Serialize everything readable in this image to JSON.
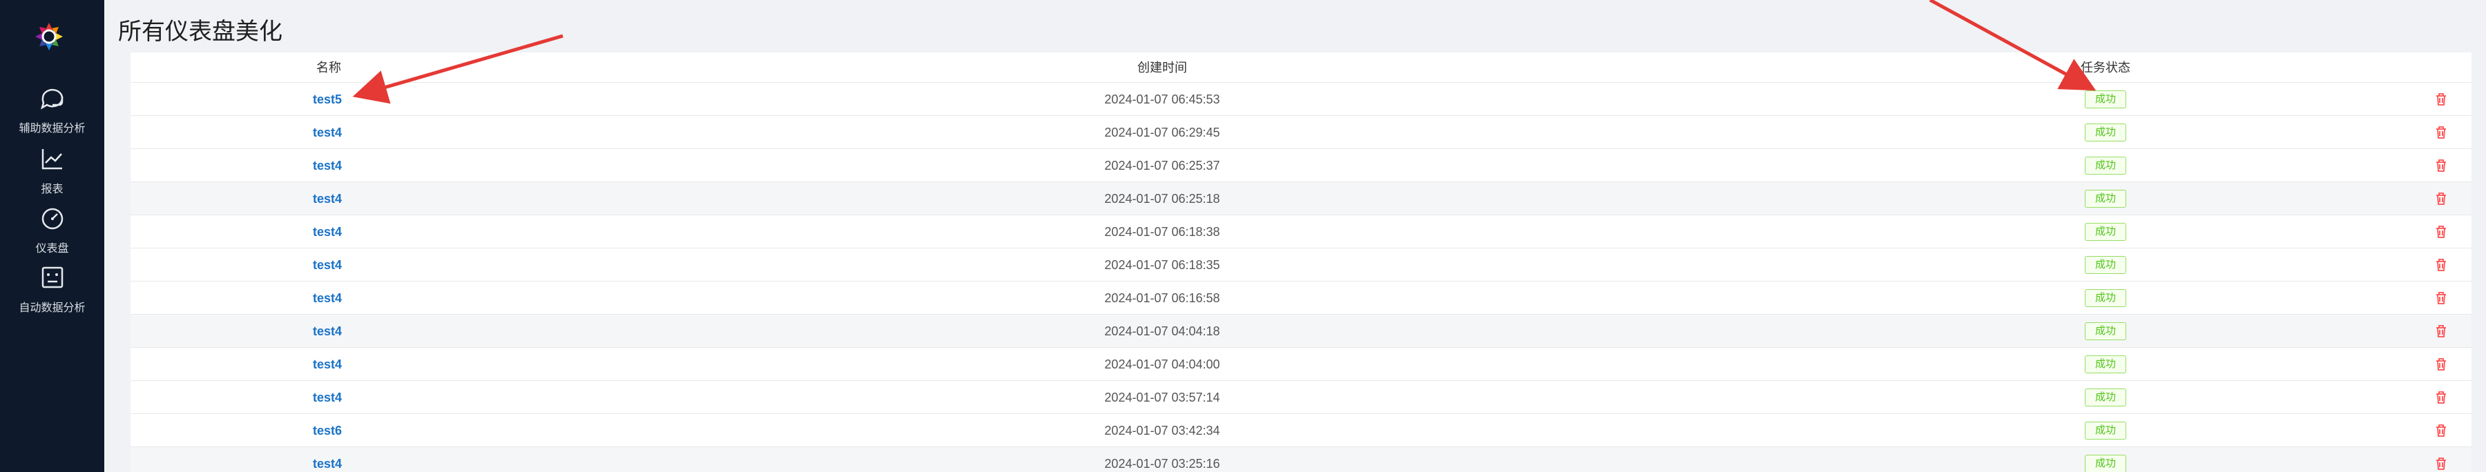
{
  "sidebar": {
    "logo_icon": "colorful-gear-logo",
    "items": [
      {
        "label": "辅助数据分析",
        "icon": "chat-bubble-icon"
      },
      {
        "label": "报表",
        "icon": "line-chart-icon"
      },
      {
        "label": "仪表盘",
        "icon": "gauge-icon"
      },
      {
        "label": "自动数据分析",
        "icon": "robot-face-icon"
      }
    ]
  },
  "page": {
    "title": "所有仪表盘美化"
  },
  "table": {
    "headers": {
      "name": "名称",
      "created": "创建时间",
      "status": "任务状态"
    },
    "rows": [
      {
        "name": "test5",
        "created": "2024-01-07 06:45:53",
        "status": "成功"
      },
      {
        "name": "test4",
        "created": "2024-01-07 06:29:45",
        "status": "成功"
      },
      {
        "name": "test4",
        "created": "2024-01-07 06:25:37",
        "status": "成功"
      },
      {
        "name": "test4",
        "created": "2024-01-07 06:25:18",
        "status": "成功"
      },
      {
        "name": "test4",
        "created": "2024-01-07 06:18:38",
        "status": "成功"
      },
      {
        "name": "test4",
        "created": "2024-01-07 06:18:35",
        "status": "成功"
      },
      {
        "name": "test4",
        "created": "2024-01-07 06:16:58",
        "status": "成功"
      },
      {
        "name": "test4",
        "created": "2024-01-07 04:04:18",
        "status": "成功"
      },
      {
        "name": "test4",
        "created": "2024-01-07 04:04:00",
        "status": "成功"
      },
      {
        "name": "test4",
        "created": "2024-01-07 03:57:14",
        "status": "成功"
      },
      {
        "name": "test6",
        "created": "2024-01-07 03:42:34",
        "status": "成功"
      },
      {
        "name": "test4",
        "created": "2024-01-07 03:25:16",
        "status": "成功"
      }
    ]
  },
  "colors": {
    "sidebar_bg": "#0e1a2b",
    "link": "#1a73c8",
    "success": "#52c41a",
    "danger": "#ff4d4f",
    "annotation_arrow": "#e53935"
  }
}
